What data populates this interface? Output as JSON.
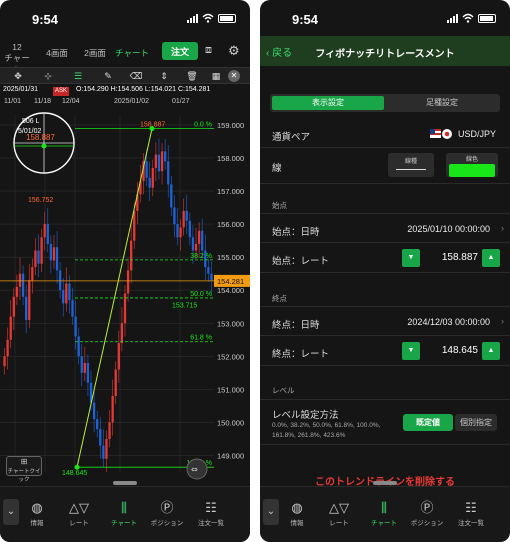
{
  "status": {
    "time": "9:54"
  },
  "left": {
    "tabs": [
      {
        "top": "12",
        "label": "チャート"
      },
      {
        "label": "4画面"
      },
      {
        "label": "2画面"
      },
      {
        "label": "チャート"
      }
    ],
    "order_label": "注文",
    "toolbar": [
      "move-icon",
      "crosshair-icon",
      "fibo-icon",
      "add-tool-icon",
      "eraser-icon",
      "fit-icon",
      "trash-icon",
      "layout-icon"
    ],
    "quote": {
      "datetime": "2025/01/31",
      "side": "ASK",
      "ohlc": "O:154.290  H:154.506  L:154.021  C:154.281"
    },
    "xaxis": {
      "d1": "11/01",
      "d2": "11/18",
      "d3": "12/04",
      "d4": "2025/01/02",
      "d5": "01/27"
    },
    "magnifier": {
      "date_frag1": "506 L",
      "date_frag2": "5/01/02",
      "rate": "158.887"
    },
    "price_labels": {
      "p156": "156.752",
      "p153": "153.715",
      "p148": "148.645"
    },
    "fib": {
      "top_label": "158.887",
      "levels": [
        {
          "name": "0.0 %",
          "price": 158.887
        },
        {
          "name": "38.2 %",
          "price": 154.918
        },
        {
          "name": "50.0 %",
          "price": 153.766
        },
        {
          "name": "61.8 %",
          "price": 152.441
        },
        {
          "name": "100.0 %",
          "price": 148.645
        }
      ]
    },
    "current_price": "154.281",
    "yaxis": [
      "159.000",
      "158.000",
      "157.000",
      "156.000",
      "155.000",
      "154.000",
      "153.000",
      "152.000",
      "151.000",
      "150.000",
      "149.000"
    ],
    "chart_quick": "チャートクイック",
    "chart_data": {
      "type": "candlestick",
      "symbol": "USD/JPY",
      "ylim": [
        148.5,
        159.3
      ],
      "x_ticks": [
        "11/01",
        "11/18",
        "12/04",
        "2025/01/02",
        "01/27"
      ],
      "current": 154.281,
      "high": 158.887,
      "low": 148.645,
      "candles_close": [
        152.0,
        152.5,
        153.2,
        153.8,
        154.1,
        154.5,
        153.8,
        153.1,
        154.3,
        154.7,
        155.2,
        154.8,
        155.6,
        156.0,
        155.4,
        154.9,
        155.3,
        154.6,
        154.0,
        153.6,
        154.2,
        153.7,
        153.2,
        152.6,
        152.0,
        151.5,
        151.8,
        151.2,
        150.6,
        150.1,
        149.8,
        149.3,
        148.9,
        149.5,
        150.0,
        150.8,
        151.6,
        152.4,
        153.0,
        153.9,
        154.6,
        155.5,
        156.4,
        156.9,
        157.3,
        157.9,
        157.4,
        157.1,
        157.7,
        158.1,
        157.6,
        158.2,
        157.9,
        157.2,
        156.5,
        156.0,
        155.6,
        155.9,
        156.4,
        156.1,
        155.6,
        155.2,
        155.4,
        155.8,
        155.2,
        154.7,
        154.5,
        154.3
      ]
    },
    "bottom_nav": [
      {
        "icon": "globe-icon",
        "label": "情報"
      },
      {
        "icon": "rate-icon",
        "label": "レート"
      },
      {
        "icon": "chart-icon",
        "label": "チャート"
      },
      {
        "icon": "position-icon",
        "label": "ポジション"
      },
      {
        "icon": "list-icon",
        "label": "注文一覧"
      }
    ]
  },
  "right": {
    "back_label": "戻る",
    "title": "フィボナッチリトレースメント",
    "segments": [
      "表示設定",
      "足種設定"
    ],
    "pair_label": "通貨ペア",
    "pair_value": "USD/JPY",
    "line_label": "線",
    "line_type_label": "線種",
    "line_color_label": "線色",
    "line_color": "#19e619",
    "start": {
      "section": "始点",
      "date_label": "始点：日時",
      "date_value": "2025/01/10 00:00:00",
      "rate_label": "始点：レート",
      "rate_value": "158.887"
    },
    "end": {
      "section": "終点",
      "date_label": "終点：日時",
      "date_value": "2024/12/03 00:00:00",
      "rate_label": "終点：レート",
      "rate_value": "148.645"
    },
    "level": {
      "section": "レベル",
      "label": "レベル設定方法",
      "values_line1": "0.0%, 38.2%, 50.0%, 61.8%, 100.0%,",
      "values_line2": "161.8%, 261.8%, 423.6%",
      "btn_default": "既定値",
      "btn_custom": "個別指定"
    },
    "delete_label": "このトレンドラインを削除する",
    "bottom_nav": [
      {
        "icon": "globe-icon",
        "label": "情報"
      },
      {
        "icon": "rate-icon",
        "label": "レート"
      },
      {
        "icon": "chart-icon",
        "label": "チャート"
      },
      {
        "icon": "position-icon",
        "label": "ポジション"
      },
      {
        "icon": "list-icon",
        "label": "注文一覧"
      }
    ]
  }
}
